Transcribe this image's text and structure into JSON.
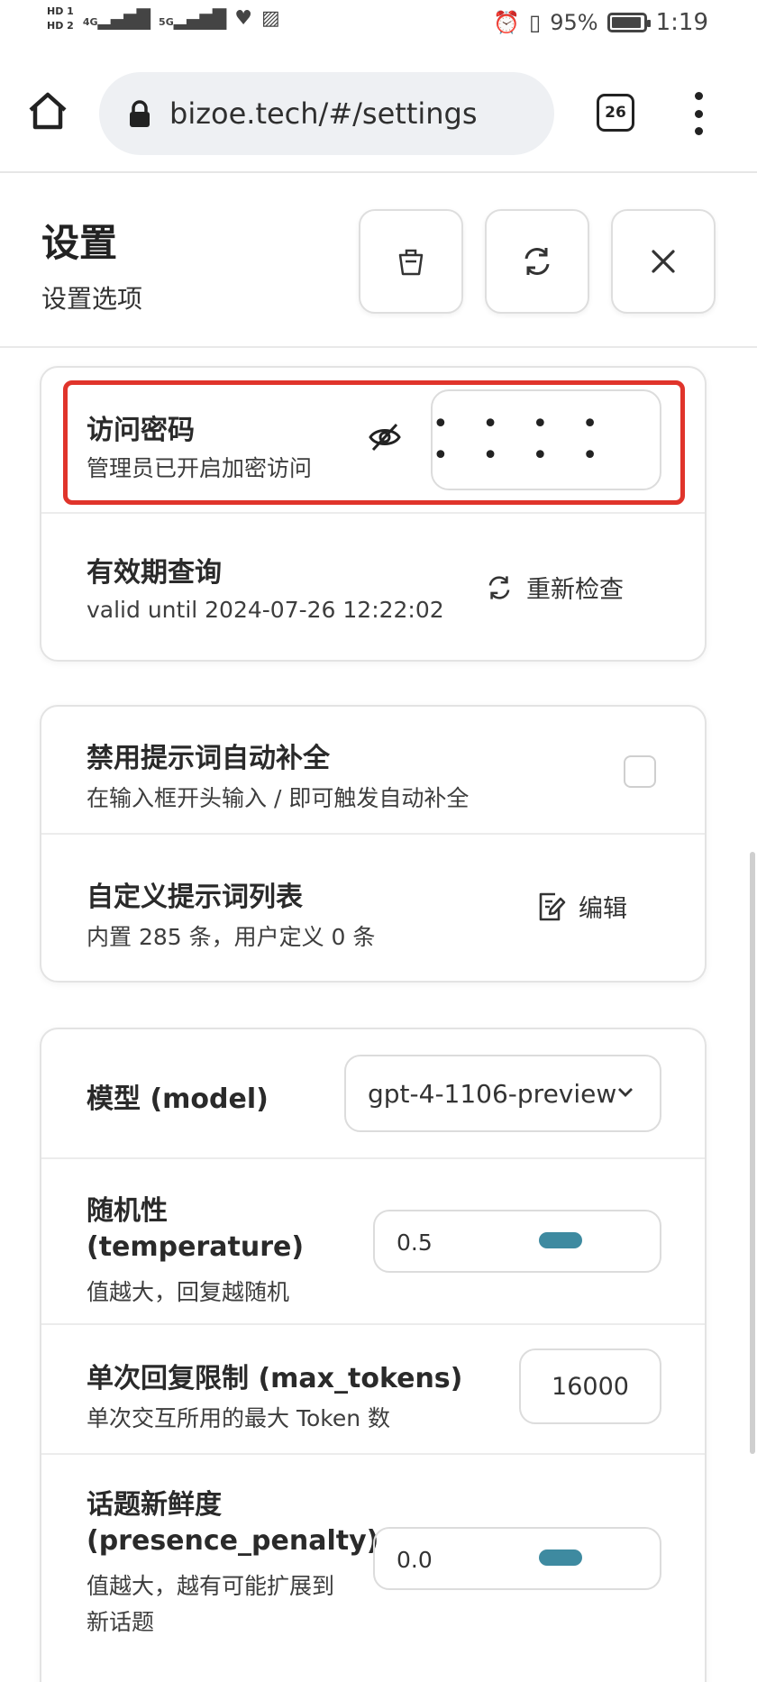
{
  "status_bar": {
    "hd1": "HD 1",
    "hd2": "HD 2",
    "net1": "4G",
    "net2": "5G",
    "battery_pct": "95%",
    "battery_level": 0.95,
    "time": "1:19"
  },
  "browser": {
    "url": "bizoe.tech/#/settings",
    "tab_count": "26"
  },
  "header": {
    "title": "设置",
    "subtitle": "设置选项"
  },
  "access": {
    "title": "访问密码",
    "subtitle": "管理员已开启加密访问",
    "password_masked": "• • • • • • • •"
  },
  "validity": {
    "title": "有效期查询",
    "subtitle": "valid until 2024-07-26 12:22:02",
    "action": "重新检查"
  },
  "prompts": {
    "disable_title": "禁用提示词自动补全",
    "disable_sub": "在输入框开头输入 / 即可触发自动补全",
    "disable_checked": false,
    "custom_title": "自定义提示词列表",
    "custom_sub": "内置 285 条，用户定义 0 条",
    "edit_label": "编辑"
  },
  "model": {
    "label": "模型 (model)",
    "selected": "gpt-4-1106-preview"
  },
  "temperature": {
    "title_line1": "随机性",
    "title_line2": "(temperature)",
    "subtitle": "值越大，回复越随机",
    "value": "0.5",
    "position": 0.5
  },
  "max_tokens": {
    "title": "单次回复限制 (max_tokens)",
    "subtitle": "单次交互所用的最大 Token 数",
    "value": "16000"
  },
  "presence": {
    "title_line1": "话题新鲜度",
    "title_line2": "(presence_penalty)",
    "subtitle_line1": "值越大，越有可能扩展到",
    "subtitle_line2": "新话题",
    "value": "0.0",
    "position": 0.5
  },
  "colors": {
    "highlight": "#e0342b",
    "slider_thumb": "#3e8aa0"
  }
}
